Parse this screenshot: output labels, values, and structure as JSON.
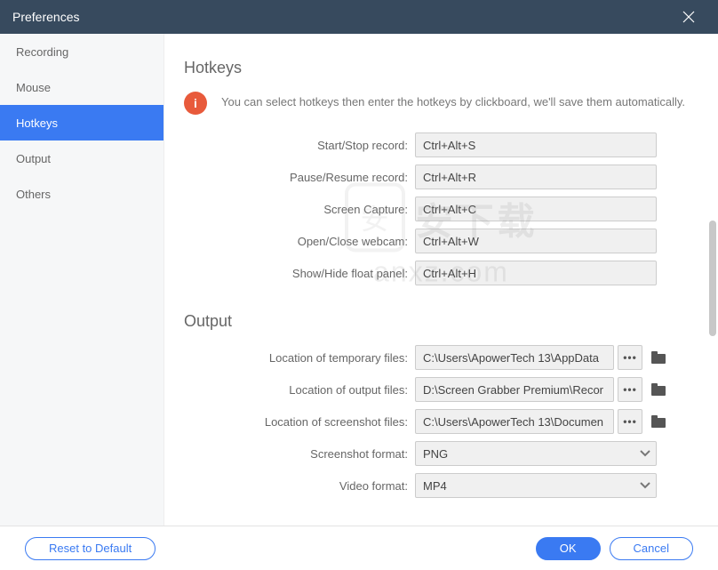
{
  "title": "Preferences",
  "sidebar": {
    "items": [
      {
        "label": "Recording"
      },
      {
        "label": "Mouse"
      },
      {
        "label": "Hotkeys"
      },
      {
        "label": "Output"
      },
      {
        "label": "Others"
      }
    ]
  },
  "hotkeys_section": {
    "title": "Hotkeys",
    "info": "You can select hotkeys then enter the hotkeys by clickboard, we'll save them automatically.",
    "rows": [
      {
        "label": "Start/Stop record:",
        "value": "Ctrl+Alt+S"
      },
      {
        "label": "Pause/Resume record:",
        "value": "Ctrl+Alt+R"
      },
      {
        "label": "Screen Capture:",
        "value": "Ctrl+Alt+C"
      },
      {
        "label": "Open/Close webcam:",
        "value": "Ctrl+Alt+W"
      },
      {
        "label": "Show/Hide float panel:",
        "value": "Ctrl+Alt+H"
      }
    ]
  },
  "output_section": {
    "title": "Output",
    "paths": [
      {
        "label": "Location of temporary files:",
        "value": "C:\\Users\\ApowerTech 13\\AppData"
      },
      {
        "label": "Location of output files:",
        "value": "D:\\Screen Grabber Premium\\Recor"
      },
      {
        "label": "Location of screenshot files:",
        "value": "C:\\Users\\ApowerTech 13\\Documen"
      }
    ],
    "formats": [
      {
        "label": "Screenshot format:",
        "value": "PNG"
      },
      {
        "label": "Video format:",
        "value": "MP4"
      }
    ]
  },
  "footer": {
    "reset": "Reset to Default",
    "ok": "OK",
    "cancel": "Cancel"
  },
  "watermark": {
    "cn": "安下载",
    "en": "anxz.com",
    "shield": "安"
  }
}
